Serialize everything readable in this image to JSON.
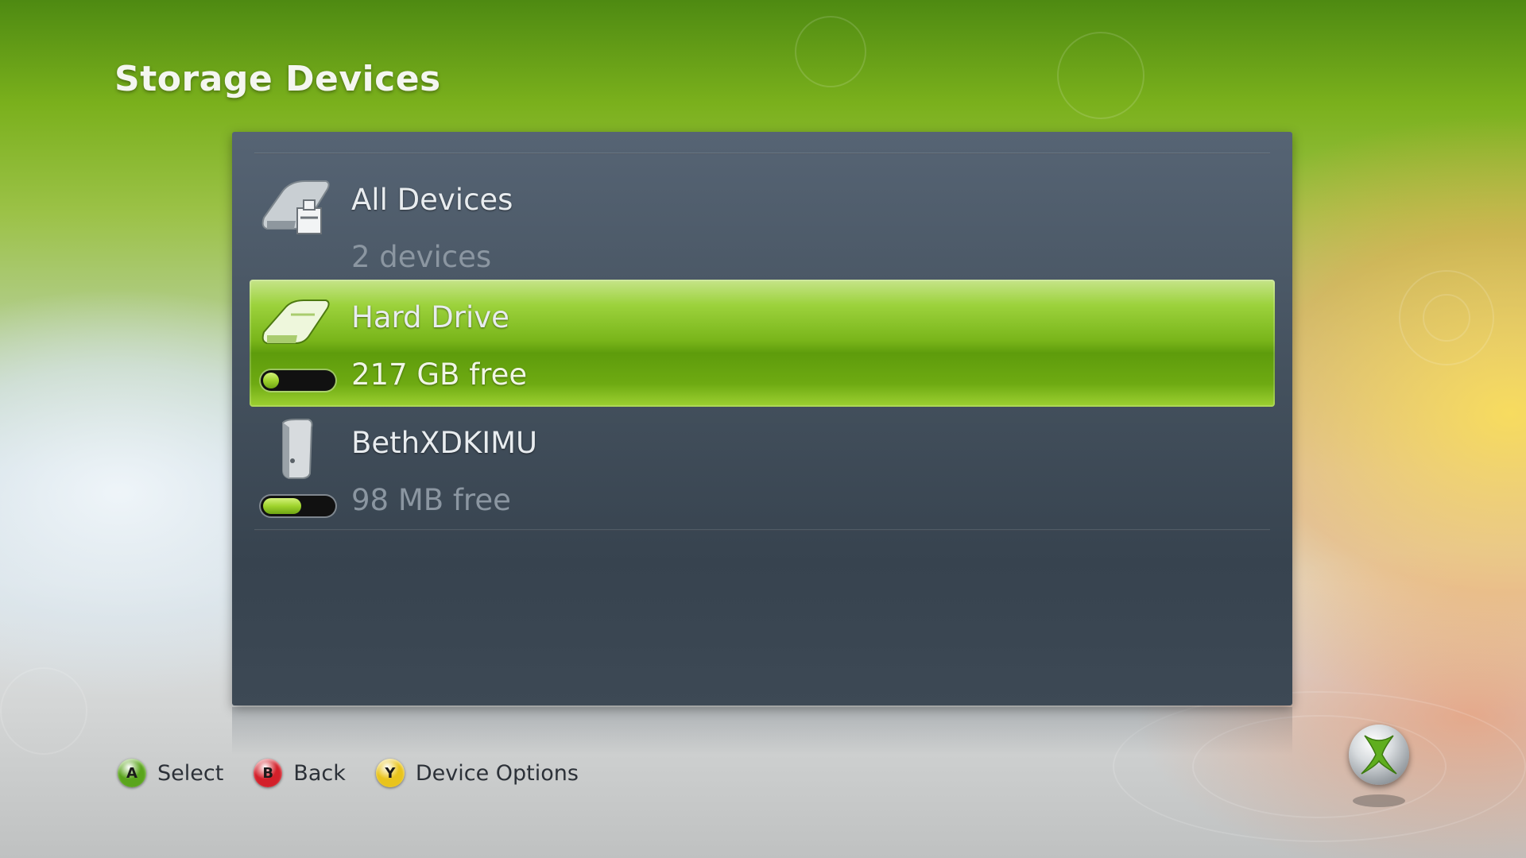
{
  "page": {
    "title": "Storage Devices"
  },
  "devices": [
    {
      "name": "All Devices",
      "sub": "2 devices",
      "icon": "all-devices-icon",
      "selected": false
    },
    {
      "name": "Hard Drive",
      "sub": "217 GB free",
      "icon": "hard-drive-icon",
      "selected": true,
      "free_fraction": 0.04
    },
    {
      "name": "BethXDKIMU",
      "sub": "98 MB free",
      "icon": "memory-unit-icon",
      "selected": false,
      "free_fraction": 0.55
    }
  ],
  "footer": {
    "hints": [
      {
        "button": "A",
        "label": "Select",
        "color": "#5aa51c"
      },
      {
        "button": "B",
        "label": "Back",
        "color": "#d3202a"
      },
      {
        "button": "Y",
        "label": "Device Options",
        "color": "#e9c41c"
      }
    ]
  },
  "theme": {
    "accent": "#79b51a",
    "panel": "#45525f"
  }
}
